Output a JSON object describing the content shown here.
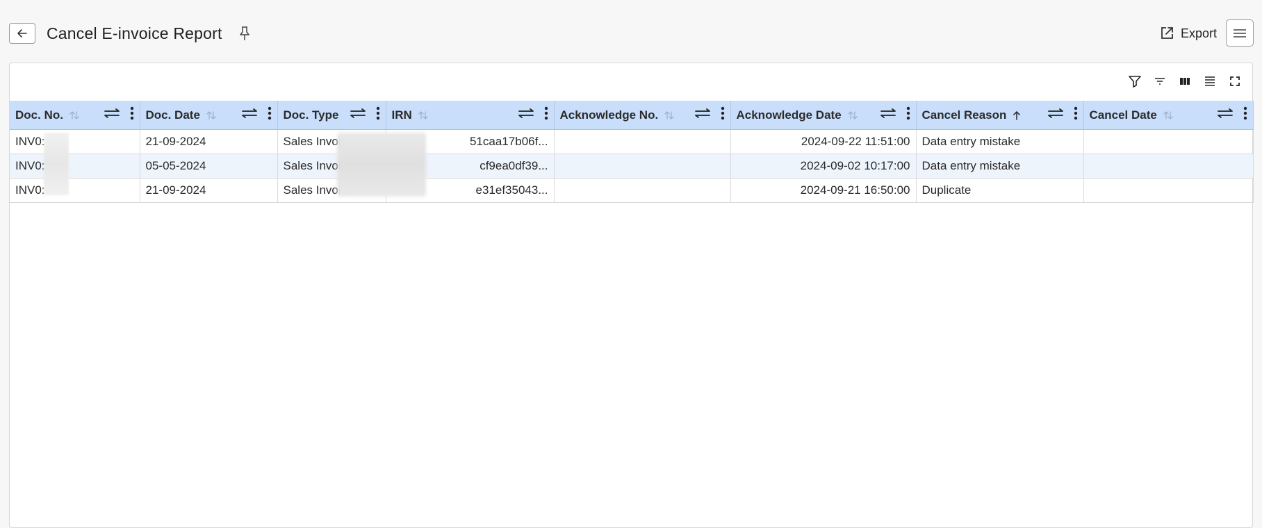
{
  "header": {
    "title": "Cancel E-invoice Report",
    "export_label": "Export"
  },
  "table": {
    "columns": [
      {
        "key": "doc_no",
        "label": "Doc. No.",
        "sort": "none"
      },
      {
        "key": "doc_date",
        "label": "Doc. Date",
        "sort": "none"
      },
      {
        "key": "doc_type",
        "label": "Doc. Type",
        "sort": "none"
      },
      {
        "key": "irn",
        "label": "IRN",
        "sort": "none"
      },
      {
        "key": "ack_no",
        "label": "Acknowledge No.",
        "sort": "none"
      },
      {
        "key": "ack_date",
        "label": "Acknowledge Date",
        "sort": "none"
      },
      {
        "key": "cancel_reason",
        "label": "Cancel Reason",
        "sort": "ascending"
      },
      {
        "key": "cancel_date",
        "label": "Cancel Date",
        "sort": "none"
      }
    ],
    "rows": [
      {
        "doc_no": "INV0:",
        "doc_date": "21-09-2024",
        "doc_type": "Sales Invoice",
        "irn": "51caa17b06f...",
        "ack_no": "",
        "ack_date": "2024-09-22 11:51:00",
        "cancel_reason": "Data entry mistake",
        "cancel_date": ""
      },
      {
        "doc_no": "INV0:",
        "doc_date": "05-05-2024",
        "doc_type": "Sales Invoice",
        "irn": "cf9ea0df39...",
        "ack_no": "",
        "ack_date": "2024-09-02 10:17:00",
        "cancel_reason": "Data entry mistake",
        "cancel_date": ""
      },
      {
        "doc_no": "INV0:",
        "doc_date": "21-09-2024",
        "doc_type": "Sales Invoice",
        "irn": "e31ef35043...",
        "ack_no": "",
        "ack_date": "2024-09-21 16:50:00",
        "cancel_reason": "Duplicate",
        "cancel_date": ""
      }
    ]
  },
  "toolbar": {
    "icons": [
      "filter-icon",
      "filter-lines-icon",
      "columns-icon",
      "density-icon",
      "fullscreen-icon"
    ]
  },
  "colors": {
    "header_bg": "#c9defb",
    "alt_row_bg": "#eef4fc"
  }
}
